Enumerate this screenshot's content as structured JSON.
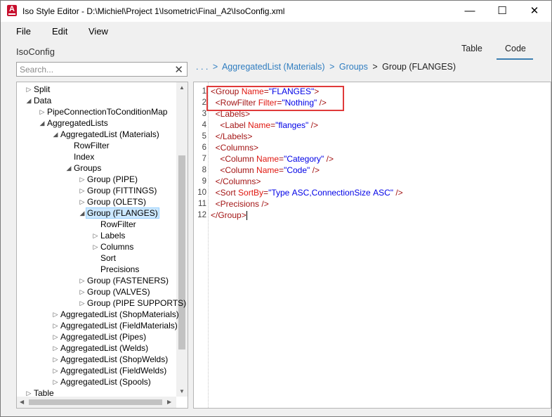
{
  "window": {
    "title": "Iso Style Editor - D:\\Michiel\\Project 1\\Isometric\\Final_A2\\IsoConfig.xml",
    "app_icon_letter": "A",
    "controls": {
      "minimize": "—",
      "maximize": "☐",
      "close": "✕"
    }
  },
  "menu": [
    "File",
    "Edit",
    "View"
  ],
  "header": {
    "config_label": "IsoConfig"
  },
  "tabs": [
    {
      "label": "Table",
      "active": false
    },
    {
      "label": "Code",
      "active": true
    }
  ],
  "search": {
    "placeholder": "Search...",
    "clear_icon": "✕"
  },
  "breadcrumb": {
    "ellipsis": ". . .",
    "separator": ">",
    "items": [
      "AggregatedList (Materials)",
      "Groups"
    ],
    "current": "Group (FLANGES)"
  },
  "tree": {
    "nodes": [
      {
        "label": "Split",
        "expander": "collapsed"
      },
      {
        "label": "Data",
        "expander": "expanded"
      },
      {
        "label": "PipeConnectionToConditionMap",
        "expander": "collapsed"
      },
      {
        "label": "AggregatedLists",
        "expander": "expanded"
      },
      {
        "label": "AggregatedList (Materials)",
        "expander": "expanded"
      },
      {
        "label": "RowFilter",
        "expander": "none"
      },
      {
        "label": "Index",
        "expander": "none"
      },
      {
        "label": "Groups",
        "expander": "expanded"
      },
      {
        "label": "Group (PIPE)",
        "expander": "collapsed"
      },
      {
        "label": "Group (FITTINGS)",
        "expander": "collapsed"
      },
      {
        "label": "Group (OLETS)",
        "expander": "collapsed"
      },
      {
        "label": "Group (FLANGES)",
        "expander": "expanded",
        "selected": true
      },
      {
        "label": "RowFilter",
        "expander": "none"
      },
      {
        "label": "Labels",
        "expander": "collapsed"
      },
      {
        "label": "Columns",
        "expander": "collapsed"
      },
      {
        "label": "Sort",
        "expander": "none"
      },
      {
        "label": "Precisions",
        "expander": "none"
      },
      {
        "label": "Group (FASTENERS)",
        "expander": "collapsed"
      },
      {
        "label": "Group (VALVES)",
        "expander": "collapsed"
      },
      {
        "label": "Group (PIPE SUPPORTS)",
        "expander": "collapsed"
      },
      {
        "label": "AggregatedList (ShopMaterials)",
        "expander": "collapsed"
      },
      {
        "label": "AggregatedList (FieldMaterials)",
        "expander": "collapsed"
      },
      {
        "label": "AggregatedList (Pipes)",
        "expander": "collapsed"
      },
      {
        "label": "AggregatedList (Welds)",
        "expander": "collapsed"
      },
      {
        "label": "AggregatedList (ShopWelds)",
        "expander": "collapsed"
      },
      {
        "label": "AggregatedList (FieldWelds)",
        "expander": "collapsed"
      },
      {
        "label": "AggregatedList (Spools)",
        "expander": "collapsed"
      },
      {
        "label": "Table",
        "expander": "collapsed"
      }
    ]
  },
  "code": {
    "lines": [
      {
        "n": "1",
        "parts": [
          [
            "tg",
            "<Group "
          ],
          [
            "at",
            "Name"
          ],
          [
            "tg",
            "="
          ],
          [
            "vl",
            "\"FLANGES\""
          ],
          [
            "tg",
            ">"
          ]
        ]
      },
      {
        "n": "2",
        "parts": [
          [
            "tg",
            "  <RowFilter "
          ],
          [
            "at",
            "Filter"
          ],
          [
            "tg",
            "="
          ],
          [
            "vl",
            "\"Nothing\""
          ],
          [
            "tg",
            " />"
          ]
        ]
      },
      {
        "n": "3",
        "parts": [
          [
            "tg",
            "  <Labels>"
          ]
        ]
      },
      {
        "n": "4",
        "parts": [
          [
            "tg",
            "    <Label "
          ],
          [
            "at",
            "Name"
          ],
          [
            "tg",
            "="
          ],
          [
            "vl",
            "\"flanges\""
          ],
          [
            "tg",
            " />"
          ]
        ]
      },
      {
        "n": "5",
        "parts": [
          [
            "tg",
            "  </Labels>"
          ]
        ]
      },
      {
        "n": "6",
        "parts": [
          [
            "tg",
            "  <Columns>"
          ]
        ]
      },
      {
        "n": "7",
        "parts": [
          [
            "tg",
            "    <Column "
          ],
          [
            "at",
            "Name"
          ],
          [
            "tg",
            "="
          ],
          [
            "vl",
            "\"Category\""
          ],
          [
            "tg",
            " />"
          ]
        ]
      },
      {
        "n": "8",
        "parts": [
          [
            "tg",
            "    <Column "
          ],
          [
            "at",
            "Name"
          ],
          [
            "tg",
            "="
          ],
          [
            "vl",
            "\"Code\""
          ],
          [
            "tg",
            " />"
          ]
        ]
      },
      {
        "n": "9",
        "parts": [
          [
            "tg",
            "  </Columns>"
          ]
        ]
      },
      {
        "n": "10",
        "parts": [
          [
            "tg",
            "  <Sort "
          ],
          [
            "at",
            "SortBy"
          ],
          [
            "tg",
            "="
          ],
          [
            "vl",
            "\"Type ASC,ConnectionSize ASC\""
          ],
          [
            "tg",
            " />"
          ]
        ]
      },
      {
        "n": "11",
        "parts": [
          [
            "tg",
            "  <Precisions />"
          ]
        ]
      },
      {
        "n": "12",
        "parts": [
          [
            "tg",
            "</Group>"
          ]
        ]
      }
    ]
  },
  "colors": {
    "tag": "#a31515",
    "attribute": "#e0160f",
    "value": "#0000e6",
    "highlight_box": "#e03a3a",
    "link": "#2f7dc0"
  }
}
